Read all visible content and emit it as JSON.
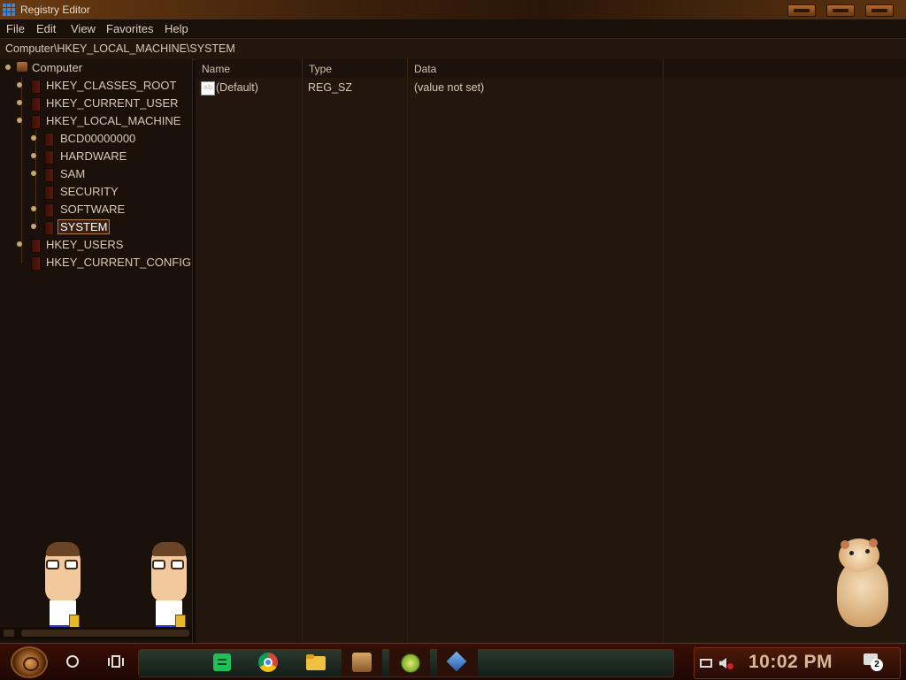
{
  "window": {
    "title": "Registry Editor"
  },
  "menu": [
    "File",
    "Edit",
    "View",
    "Favorites",
    "Help"
  ],
  "address": {
    "path": "Computer\\HKEY_LOCAL_MACHINE\\SYSTEM"
  },
  "tree": {
    "root": "Computer",
    "hives": [
      "HKEY_CLASSES_ROOT",
      "HKEY_CURRENT_USER",
      "HKEY_LOCAL_MACHINE",
      "HKEY_USERS",
      "HKEY_CURRENT_CONFIG"
    ],
    "hklm_children": [
      "BCD00000000",
      "HARDWARE",
      "SAM",
      "SECURITY",
      "SOFTWARE",
      "SYSTEM"
    ],
    "selected": "SYSTEM"
  },
  "list": {
    "columns": [
      "Name",
      "Type",
      "Data"
    ],
    "rows": [
      {
        "name": "(Default)",
        "type": "REG_SZ",
        "data": "(value not set)"
      }
    ]
  },
  "taskbar": {
    "icons": [
      "sticky-notes-icon",
      "chrome-icon",
      "file-explorer-icon",
      "game-icon",
      "green-circle-icon",
      "cube-icon"
    ],
    "tray_icons": [
      "network-icon",
      "volume-muted-icon"
    ],
    "clock": "10:02 PM",
    "notifications_count": "2"
  },
  "colors": {
    "accent": "#7a2810",
    "background": "#23170d",
    "selected_border": "#b07a46"
  }
}
